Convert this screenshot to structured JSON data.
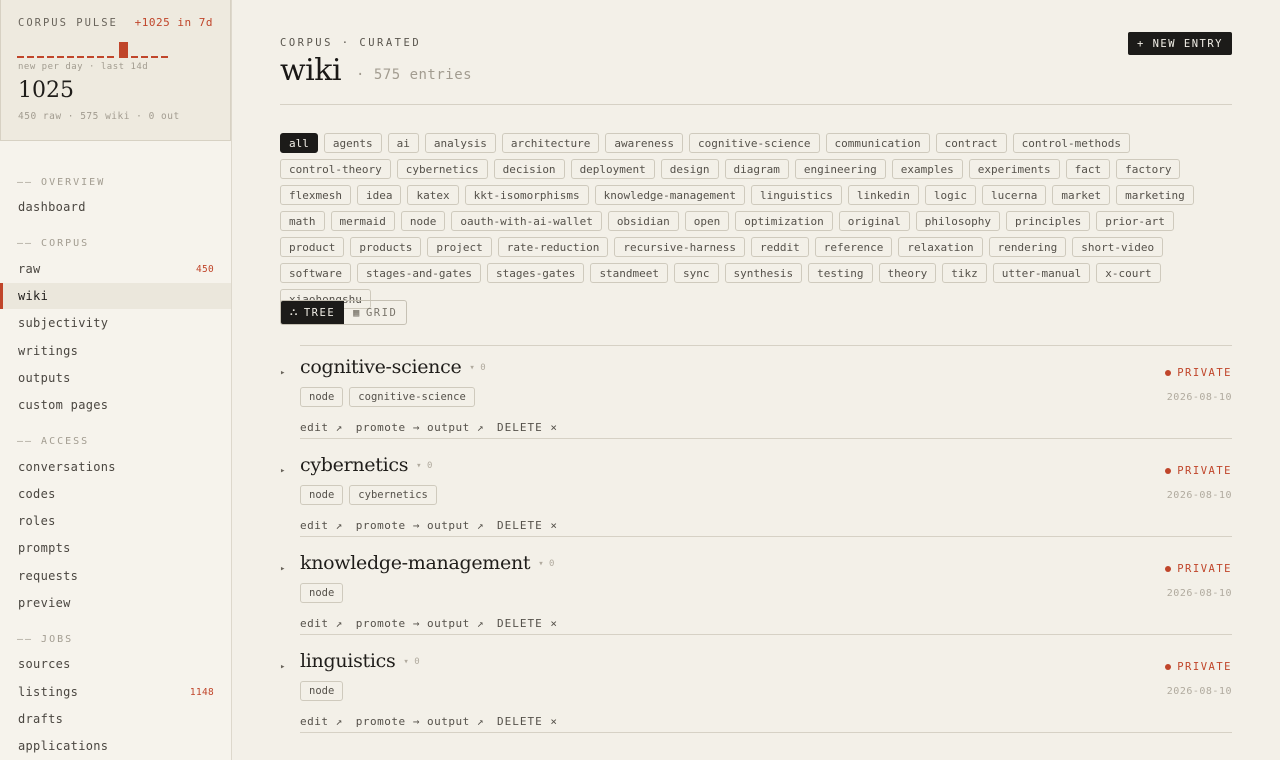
{
  "pulse": {
    "title": "CORPUS PULSE",
    "delta": "+1025 in 7d",
    "sub": "new per day · last 14d",
    "value": "1025",
    "foot": "450 raw · 575 wiki · 0 out",
    "accent": "#c0452a"
  },
  "nav": {
    "overview": {
      "header": "—— OVERVIEW",
      "items": [
        {
          "label": "dashboard"
        }
      ]
    },
    "corpus": {
      "header": "—— CORPUS",
      "items": [
        {
          "label": "raw",
          "count": "450"
        },
        {
          "label": "wiki"
        },
        {
          "label": "subjectivity"
        },
        {
          "label": "writings"
        },
        {
          "label": "outputs"
        },
        {
          "label": "custom pages"
        }
      ]
    },
    "access": {
      "header": "—— ACCESS",
      "items": [
        {
          "label": "conversations"
        },
        {
          "label": "codes"
        },
        {
          "label": "roles"
        },
        {
          "label": "prompts"
        },
        {
          "label": "requests"
        },
        {
          "label": "preview"
        }
      ]
    },
    "jobs": {
      "header": "—— JOBS",
      "items": [
        {
          "label": "sources"
        },
        {
          "label": "listings",
          "count": "1148"
        },
        {
          "label": "drafts"
        },
        {
          "label": "applications"
        }
      ]
    }
  },
  "header": {
    "kicker": "CORPUS · CURATED",
    "title": "wiki",
    "count": "· 575 entries",
    "new_entry": "+ NEW ENTRY"
  },
  "tags": [
    "all",
    "agents",
    "ai",
    "analysis",
    "architecture",
    "awareness",
    "cognitive-science",
    "communication",
    "contract",
    "control-methods",
    "control-theory",
    "cybernetics",
    "decision",
    "deployment",
    "design",
    "diagram",
    "engineering",
    "examples",
    "experiments",
    "fact",
    "factory",
    "flexmesh",
    "idea",
    "katex",
    "kkt-isomorphisms",
    "knowledge-management",
    "linguistics",
    "linkedin",
    "logic",
    "lucerna",
    "market",
    "marketing",
    "math",
    "mermaid",
    "node",
    "oauth-with-ai-wallet",
    "obsidian",
    "open",
    "optimization",
    "original",
    "philosophy",
    "principles",
    "prior-art",
    "product",
    "products",
    "project",
    "rate-reduction",
    "recursive-harness",
    "reddit",
    "reference",
    "relaxation",
    "rendering",
    "short-video",
    "software",
    "stages-and-gates",
    "stages-gates",
    "standmeet",
    "sync",
    "synthesis",
    "testing",
    "theory",
    "tikz",
    "utter-manual",
    "x-court",
    "xiaohongshu"
  ],
  "view": {
    "tree": "TREE",
    "grid": "GRID"
  },
  "entries": [
    {
      "name": "cognitive-science",
      "meta": "▾ 0",
      "private": "PRIVATE",
      "chips": [
        "node",
        "cognitive-science"
      ],
      "date": "2026-08-10",
      "edit": "edit ↗",
      "promote": "promote → output ↗",
      "delete": "DELETE ×"
    },
    {
      "name": "cybernetics",
      "meta": "▾ 0",
      "private": "PRIVATE",
      "chips": [
        "node",
        "cybernetics"
      ],
      "date": "2026-08-10",
      "edit": "edit ↗",
      "promote": "promote → output ↗",
      "delete": "DELETE ×"
    },
    {
      "name": "knowledge-management",
      "meta": "▾ 0",
      "private": "PRIVATE",
      "chips": [
        "node"
      ],
      "date": "2026-08-10",
      "edit": "edit ↗",
      "promote": "promote → output ↗",
      "delete": "DELETE ×"
    },
    {
      "name": "linguistics",
      "meta": "▾ 0",
      "private": "PRIVATE",
      "chips": [
        "node"
      ],
      "date": "2026-08-10",
      "edit": "edit ↗",
      "promote": "promote → output ↗",
      "delete": "DELETE ×"
    }
  ]
}
